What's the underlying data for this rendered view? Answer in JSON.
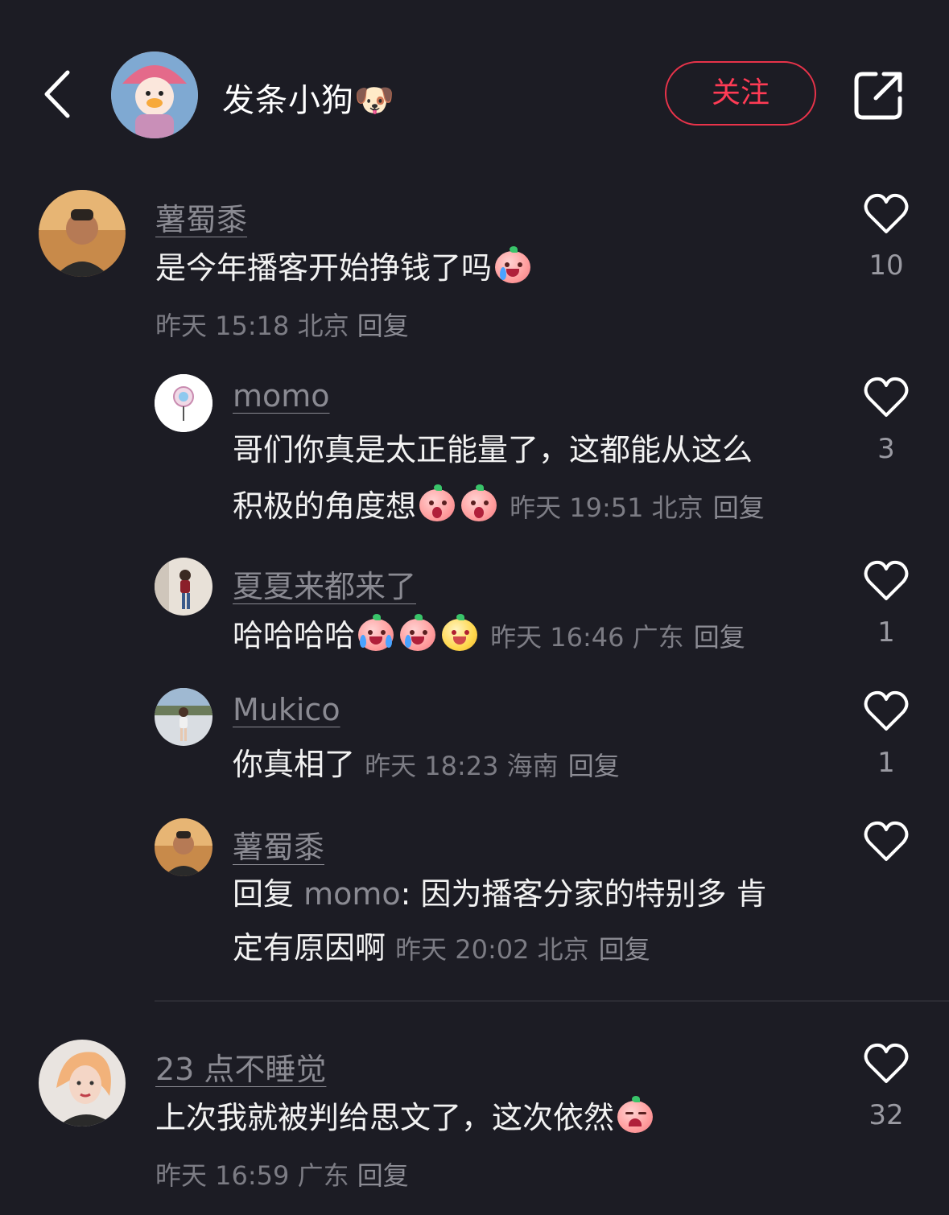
{
  "header": {
    "title": "发条小狗🐶",
    "follow_label": "关注",
    "icons": {
      "back": "chevron-left-icon",
      "share": "share-icon"
    }
  },
  "comments": [
    {
      "user": "薯蜀黍",
      "text": "是今年播客开始挣钱了吗",
      "time": "昨天 15:18 北京",
      "reply_label": "回复",
      "likes": "10"
    }
  ],
  "replies": [
    {
      "user": "momo",
      "text_line1": "哥们你真是太正能量了，这都能从这么",
      "text_line2": "积极的角度想",
      "time": "昨天 19:51 北京",
      "reply_label": "回复",
      "likes": "3"
    },
    {
      "user": "夏夏来都来了",
      "text": "哈哈哈哈",
      "time": "昨天 16:46 广东",
      "reply_label": "回复",
      "likes": "1"
    },
    {
      "user": "Mukico",
      "text": "你真相了",
      "time": "昨天 18:23 海南",
      "reply_label": "回复",
      "likes": "1"
    },
    {
      "user": "薯蜀黍",
      "reply_prefix": "回复",
      "mention": "momo",
      "text_line1": ": 因为播客分家的特别多 肯",
      "text_line2": "定有原因啊",
      "time": "昨天 20:02 北京",
      "reply_label": "回复",
      "likes": ""
    }
  ],
  "second_comment": {
    "user": "23 点不睡觉",
    "text": "上次我就被判给思文了，这次依然",
    "time": "昨天 16:59 广东",
    "reply_label": "回复",
    "likes": "32"
  },
  "colors": {
    "background": "#1c1c24",
    "accent": "#ff3b55",
    "muted_text": "#7c7c84"
  }
}
